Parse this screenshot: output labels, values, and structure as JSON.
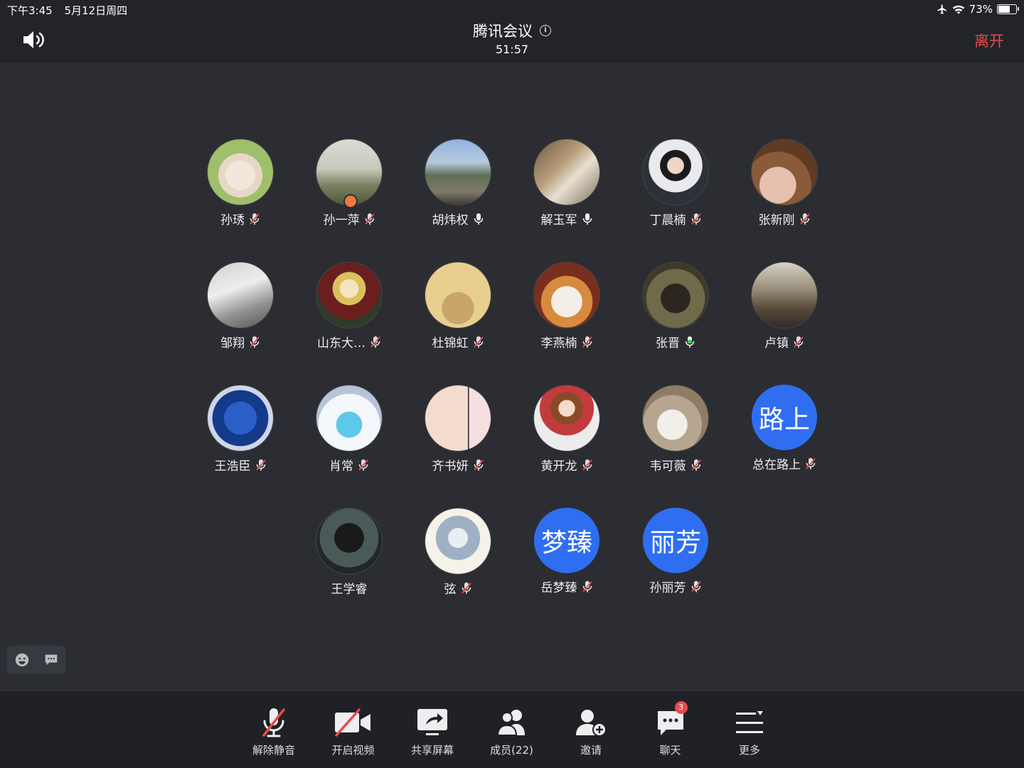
{
  "status": {
    "time": "下午3:45",
    "date": "5月12日周四",
    "battery": "73%",
    "battery_level": 0.73
  },
  "meeting": {
    "title": "腾讯会议",
    "timer": "51:57",
    "leave_label": "离开"
  },
  "participants": [
    {
      "name": "孙琇",
      "mic": "muted",
      "avatar": "teddy"
    },
    {
      "name": "孙一萍",
      "mic": "muted",
      "avatar": "paris",
      "host": true
    },
    {
      "name": "胡炜权",
      "mic": "on",
      "avatar": "town"
    },
    {
      "name": "解玉军",
      "mic": "on",
      "avatar": "room"
    },
    {
      "name": "丁晨楠",
      "mic": "muted",
      "avatar": "woman"
    },
    {
      "name": "张新刚",
      "mic": "muted",
      "avatar": "cat-brown"
    },
    {
      "name": "邹翔",
      "mic": "muted",
      "avatar": "book"
    },
    {
      "name": "山东大…",
      "mic": "muted",
      "avatar": "anime-red"
    },
    {
      "name": "杜锦虹",
      "mic": "muted",
      "avatar": "cat-yellow"
    },
    {
      "name": "李燕楠",
      "mic": "muted",
      "avatar": "cat-glasses"
    },
    {
      "name": "张晋",
      "mic": "speaking",
      "avatar": "dark-cat"
    },
    {
      "name": "卢镇",
      "mic": "muted",
      "avatar": "street"
    },
    {
      "name": "王浩臣",
      "mic": "muted",
      "avatar": "chelsea"
    },
    {
      "name": "肖常",
      "mic": "muted",
      "avatar": "blue-cat"
    },
    {
      "name": "齐书妍",
      "mic": "muted",
      "avatar": "pig"
    },
    {
      "name": "黄开龙",
      "mic": "muted",
      "avatar": "girl"
    },
    {
      "name": "韦可薇",
      "mic": "muted",
      "avatar": "cats"
    },
    {
      "name": "总在路上",
      "mic": "muted",
      "avatar": "letter",
      "letter": "路上"
    },
    {
      "name": "王学睿",
      "mic": "none",
      "avatar": "dark-man"
    },
    {
      "name": "弦",
      "mic": "muted",
      "avatar": "fantasy"
    },
    {
      "name": "岳梦臻",
      "mic": "muted",
      "avatar": "letter",
      "letter": "梦臻"
    },
    {
      "name": "孙丽芳",
      "mic": "muted",
      "avatar": "letter",
      "letter": "丽芳"
    }
  ],
  "toolbar": [
    {
      "id": "unmute",
      "label": "解除静音",
      "icon": "mic-off-icon"
    },
    {
      "id": "video",
      "label": "开启视频",
      "icon": "video-off-icon"
    },
    {
      "id": "share",
      "label": "共享屏幕",
      "icon": "share-screen-icon"
    },
    {
      "id": "members",
      "label": "成员(22)",
      "icon": "members-icon"
    },
    {
      "id": "invite",
      "label": "邀请",
      "icon": "invite-icon"
    },
    {
      "id": "chat",
      "label": "聊天",
      "icon": "chat-icon",
      "badge": "3"
    },
    {
      "id": "more",
      "label": "更多",
      "icon": "more-icon"
    }
  ],
  "colors": {
    "bg": "#2b2d33",
    "bar": "#1f2126",
    "accent": "#2f6ef0",
    "leave": "#e84b4b",
    "speaking": "#3ec35a"
  }
}
